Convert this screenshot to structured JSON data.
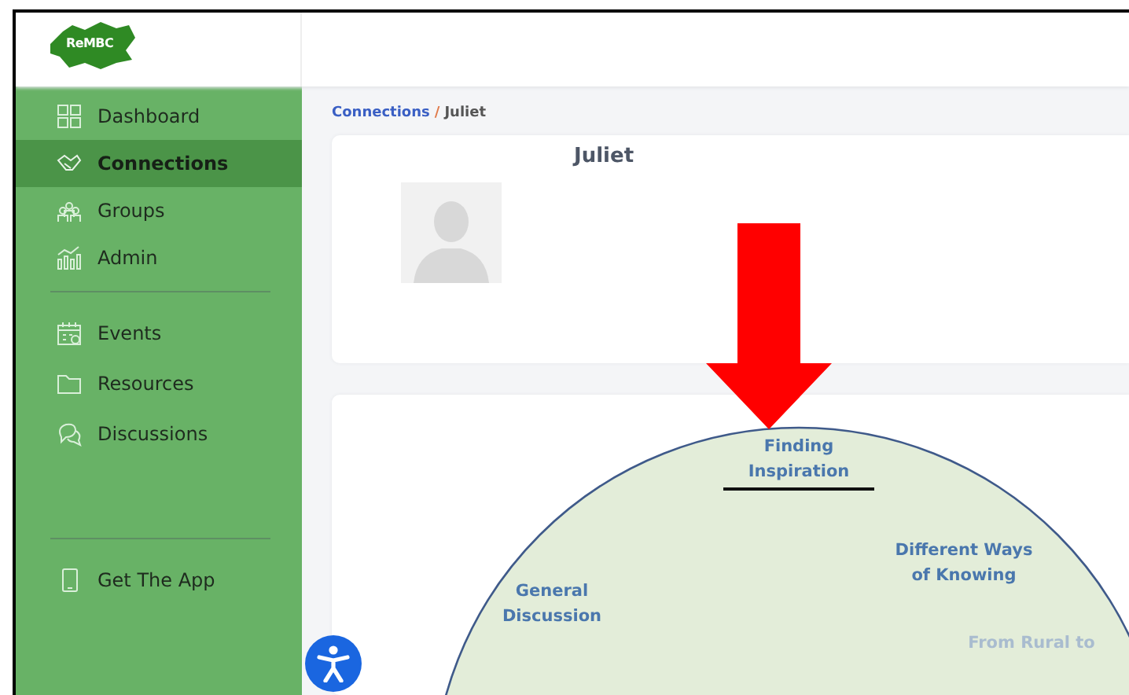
{
  "logo": {
    "text": "ReMBC"
  },
  "sidebar": {
    "groups": [
      [
        {
          "label": "Dashboard",
          "selected": false
        },
        {
          "label": "Connections",
          "selected": true
        },
        {
          "label": "Groups",
          "selected": false
        },
        {
          "label": "Admin",
          "selected": false
        }
      ],
      [
        {
          "label": "Events",
          "selected": false
        },
        {
          "label": "Resources",
          "selected": false
        },
        {
          "label": "Discussions",
          "selected": false
        }
      ],
      [
        {
          "label": "Get The App",
          "selected": false
        }
      ]
    ]
  },
  "breadcrumb": {
    "parent": "Connections",
    "separator": "/",
    "current": "Juliet"
  },
  "profile": {
    "name": "Juliet"
  },
  "topics": [
    {
      "lines": [
        "Finding",
        "Inspiration"
      ],
      "faded": false,
      "underlined": true
    },
    {
      "lines": [
        "Different Ways",
        "of Knowing"
      ],
      "faded": false,
      "underlined": false
    },
    {
      "lines": [
        "General",
        "Discussion"
      ],
      "faded": false,
      "underlined": false
    },
    {
      "lines": [
        "From Rural to"
      ],
      "faded": true,
      "underlined": false
    }
  ]
}
